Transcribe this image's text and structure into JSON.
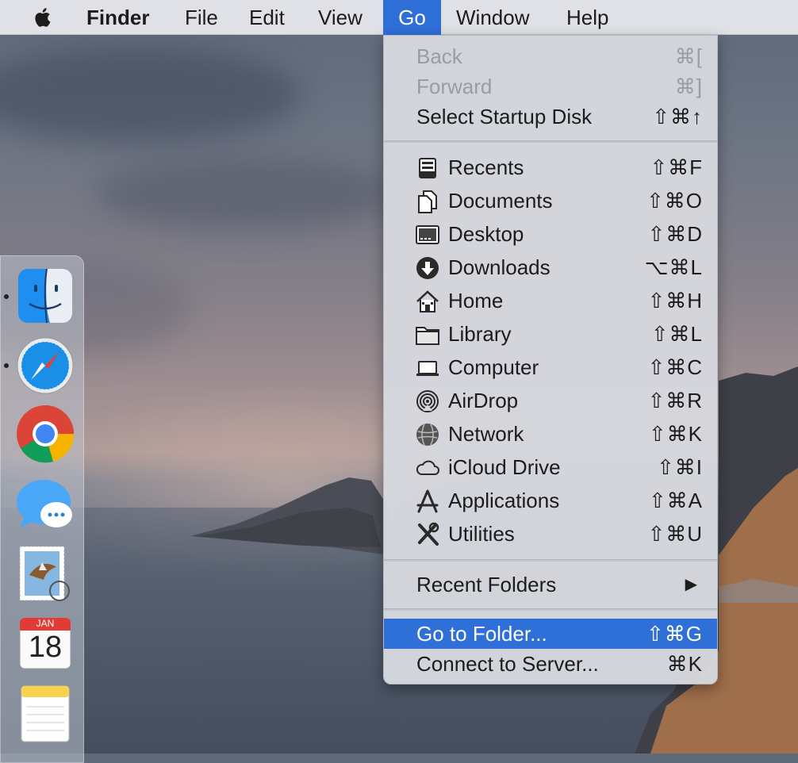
{
  "menubar": {
    "items": [
      {
        "label": "Finder",
        "bold": true
      },
      {
        "label": "File"
      },
      {
        "label": "Edit"
      },
      {
        "label": "View"
      },
      {
        "label": "Go",
        "active": true
      },
      {
        "label": "Window"
      },
      {
        "label": "Help"
      }
    ]
  },
  "go_menu": {
    "nav": [
      {
        "label": "Back",
        "shortcut": "⌘[",
        "disabled": true
      },
      {
        "label": "Forward",
        "shortcut": "⌘]",
        "disabled": true
      },
      {
        "label": "Select Startup Disk",
        "shortcut": "⇧⌘↑"
      }
    ],
    "places": [
      {
        "label": "Recents",
        "shortcut": "⇧⌘F",
        "icon": "recents-icon"
      },
      {
        "label": "Documents",
        "shortcut": "⇧⌘O",
        "icon": "documents-icon"
      },
      {
        "label": "Desktop",
        "shortcut": "⇧⌘D",
        "icon": "desktop-icon"
      },
      {
        "label": "Downloads",
        "shortcut": "⌥⌘L",
        "icon": "downloads-icon"
      },
      {
        "label": "Home",
        "shortcut": "⇧⌘H",
        "icon": "home-icon"
      },
      {
        "label": "Library",
        "shortcut": "⇧⌘L",
        "icon": "folder-icon"
      },
      {
        "label": "Computer",
        "shortcut": "⇧⌘C",
        "icon": "computer-icon"
      },
      {
        "label": "AirDrop",
        "shortcut": "⇧⌘R",
        "icon": "airdrop-icon"
      },
      {
        "label": "Network",
        "shortcut": "⇧⌘K",
        "icon": "network-icon"
      },
      {
        "label": "iCloud Drive",
        "shortcut": "⇧⌘I",
        "icon": "cloud-icon"
      },
      {
        "label": "Applications",
        "shortcut": "⇧⌘A",
        "icon": "applications-icon"
      },
      {
        "label": "Utilities",
        "shortcut": "⇧⌘U",
        "icon": "utilities-icon"
      }
    ],
    "recent_folders": {
      "label": "Recent Folders",
      "submenu_arrow": "▶"
    },
    "bottom": [
      {
        "label": "Go to Folder...",
        "shortcut": "⇧⌘G",
        "highlighted": true
      },
      {
        "label": "Connect to Server...",
        "shortcut": "⌘K"
      }
    ]
  },
  "dock": {
    "apps": [
      {
        "name": "finder-icon",
        "running": true
      },
      {
        "name": "safari-icon",
        "running": true
      },
      {
        "name": "chrome-icon"
      },
      {
        "name": "messages-icon"
      },
      {
        "name": "mail-icon"
      },
      {
        "name": "calendar-icon",
        "month": "JAN",
        "day": "18"
      },
      {
        "name": "notes-icon"
      }
    ]
  },
  "colors": {
    "highlight": "#2f6fd8",
    "menubar_bg": "#dfe1e6",
    "menu_bg": "#d6d8de"
  }
}
